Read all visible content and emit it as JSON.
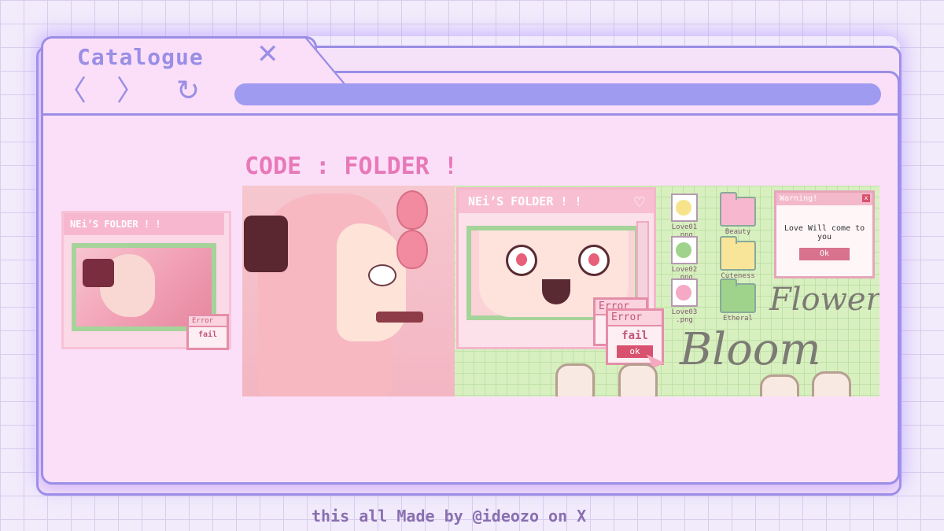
{
  "tab": {
    "title": "Catalogue",
    "close_glyph": "✕"
  },
  "nav": {
    "back_glyph": "〈",
    "forward_glyph": "〉",
    "reload_glyph": "↻"
  },
  "heading": "CODE : FOLDER !",
  "footer": "this all Made by @ideozo on X",
  "thumbnail": {
    "title": "NEi’S FOLDER ! !",
    "error": {
      "title": "Error",
      "message": "fail"
    }
  },
  "banner": {
    "folder_window": {
      "title": "NEi’S FOLDER ! !"
    },
    "error_dialog": {
      "title": "Error",
      "message": "fail",
      "ok": "ok"
    },
    "files": [
      {
        "label": "Love01\n.png",
        "color": "#f7e38a"
      },
      {
        "label": "Love02\n.png",
        "color": "#9fd38c"
      },
      {
        "label": "Love03\n.png",
        "color": "#f5a9c4"
      }
    ],
    "folders": [
      {
        "label": "Beauty",
        "color": "#f7b8cf"
      },
      {
        "label": "Cuteness",
        "color": "#f8e59a"
      },
      {
        "label": "Etheral",
        "color": "#9fd38c"
      }
    ],
    "warning": {
      "title": "Warning!",
      "message": "Love Will come to you",
      "ok": "Ok"
    },
    "script_text": {
      "line1": "Flower",
      "line2": "Bloom"
    }
  },
  "colors": {
    "frame": "#9a8ee6",
    "window_bg": "#fbdff8",
    "heading": "#e879b8",
    "banner_green": "#d8f0c0"
  }
}
